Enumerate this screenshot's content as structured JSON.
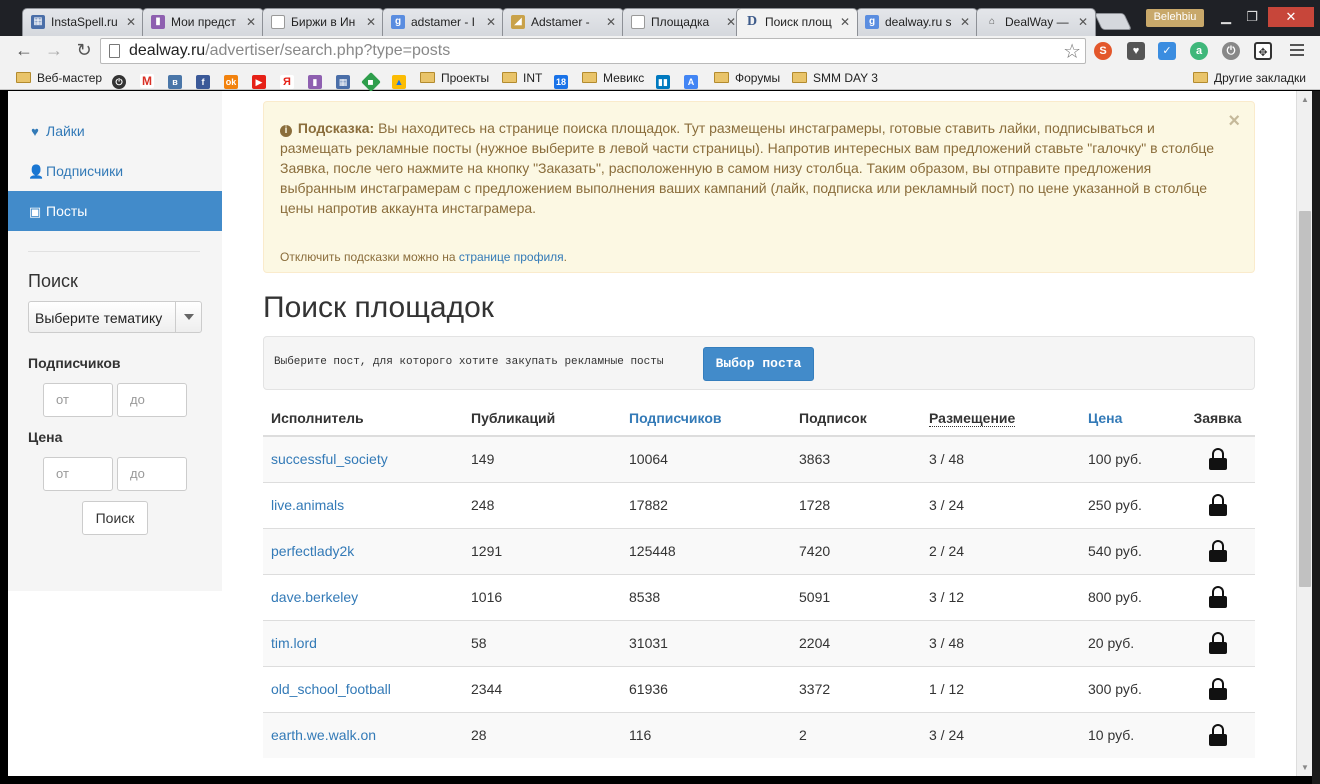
{
  "browser": {
    "tabs": [
      {
        "title": "InstaSpell.ru",
        "favicon": "instaspell-favicon",
        "active": false
      },
      {
        "title": "Мои предст",
        "favicon": "chart-favicon",
        "active": false
      },
      {
        "title": "Биржи в Ин",
        "favicon": "page-favicon",
        "active": false
      },
      {
        "title": "adstamer - I",
        "favicon": "google-favicon",
        "active": false
      },
      {
        "title": "Adstamer - ",
        "favicon": "adstamer-favicon",
        "active": false
      },
      {
        "title": "Площадка",
        "favicon": "page-favicon",
        "active": false
      },
      {
        "title": "Поиск площ",
        "favicon": "dealway-favicon",
        "active": true
      },
      {
        "title": "dealway.ru s",
        "favicon": "google-favicon",
        "active": false
      },
      {
        "title": "DealWay — ",
        "favicon": "dealway-favicon",
        "active": false
      }
    ],
    "profile_name": "Belehbiu",
    "url_host": "dealway.ru",
    "url_path": "/advertiser/search.php?type=posts",
    "bookmarks": [
      {
        "label": "Веб-мастер",
        "type": "folder"
      },
      {
        "label": "Проекты",
        "type": "folder"
      },
      {
        "label": "INT",
        "type": "folder"
      },
      {
        "label": "Мевикс",
        "type": "folder"
      },
      {
        "label": "Форумы",
        "type": "folder"
      },
      {
        "label": "SMM DAY 3",
        "type": "folder"
      },
      {
        "label": "Другие закладки",
        "type": "folder"
      }
    ]
  },
  "sidebar": {
    "items": [
      {
        "label": "Лайки",
        "icon": "heart-icon",
        "active": false
      },
      {
        "label": "Подписчики",
        "icon": "user-icon",
        "active": false
      },
      {
        "label": "Посты",
        "icon": "picture-icon",
        "active": true
      }
    ],
    "search_title": "Поиск",
    "topic_select_value": "Выберите тематику",
    "subscribers_label": "Подписчиков",
    "price_label": "Цена",
    "from_placeholder": "от",
    "to_placeholder": "до",
    "search_button": "Поиск"
  },
  "hint": {
    "title": "Подсказка:",
    "text": "Вы находитесь на странице поиска площадок. Тут размещены инстаграмеры, готовые ставить лайки, подписываться и размещать рекламные посты (нужное выберите в левой части страницы). Напротив интересных вам предложений ставьте \"галочку\" в столбце Заявка, после чего нажмите на кнопку \"Заказать\", расположенную в самом низу столбца. Таким образом, вы отправите предложения выбранным инстаграмерам с предложением выполнения ваших кампаний (лайк, подписка или рекламный пост) по цене указанной в столбце цены напротив аккаунта инстаграмера.",
    "note_prefix": "Отключить подсказки можно на ",
    "note_link": "странице профиля",
    "note_suffix": ".",
    "close": "×"
  },
  "main": {
    "title": "Поиск площадок",
    "post_prompt": "Выберите пост, для которого хотите закупать рекламные посты",
    "post_button": "Выбор поста"
  },
  "table": {
    "headers": [
      "Исполнитель",
      "Публикаций",
      "Подписчиков",
      "Подписок",
      "Размещение",
      "Цена",
      "Заявка"
    ],
    "rows": [
      {
        "name": "successful_society",
        "posts": "149",
        "followers": "10064",
        "following": "3863",
        "placement": "3 / 48",
        "price": "100 руб."
      },
      {
        "name": "live.animals",
        "posts": "248",
        "followers": "17882",
        "following": "1728",
        "placement": "3 / 24",
        "price": "250 руб."
      },
      {
        "name": "perfectlady2k",
        "posts": "1291",
        "followers": "125448",
        "following": "7420",
        "placement": "2 / 24",
        "price": "540 руб."
      },
      {
        "name": "dave.berkeley",
        "posts": "1016",
        "followers": "8538",
        "following": "5091",
        "placement": "3 / 12",
        "price": "800 руб."
      },
      {
        "name": "tim.lord",
        "posts": "58",
        "followers": "31031",
        "following": "2204",
        "placement": "3 / 48",
        "price": "20 руб."
      },
      {
        "name": "old_school_football",
        "posts": "2344",
        "followers": "61936",
        "following": "3372",
        "placement": "1 / 12",
        "price": "300 руб."
      },
      {
        "name": "earth.we.walk.on",
        "posts": "28",
        "followers": "116",
        "following": "2",
        "placement": "3 / 24",
        "price": "10 руб."
      }
    ]
  },
  "colors": {
    "link": "#337ab7",
    "primary": "#428bca",
    "hint_bg": "#fcf8e3",
    "hint_text": "#8a6d3b"
  }
}
